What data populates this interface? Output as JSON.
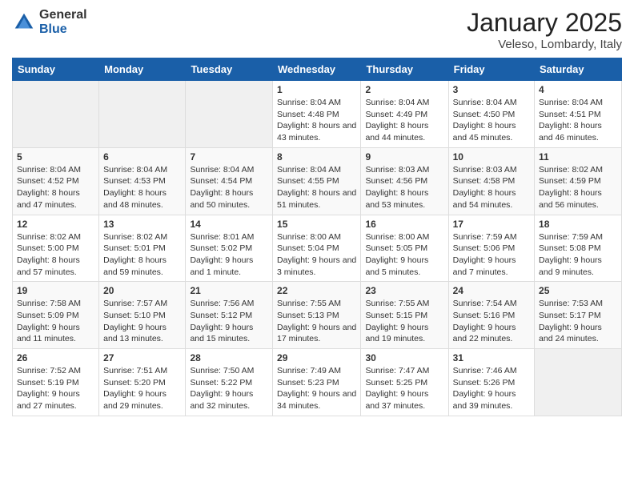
{
  "header": {
    "logo_general": "General",
    "logo_blue": "Blue",
    "month": "January 2025",
    "location": "Veleso, Lombardy, Italy"
  },
  "weekdays": [
    "Sunday",
    "Monday",
    "Tuesday",
    "Wednesday",
    "Thursday",
    "Friday",
    "Saturday"
  ],
  "weeks": [
    [
      {
        "day": "",
        "info": ""
      },
      {
        "day": "",
        "info": ""
      },
      {
        "day": "",
        "info": ""
      },
      {
        "day": "1",
        "info": "Sunrise: 8:04 AM\nSunset: 4:48 PM\nDaylight: 8 hours and 43 minutes."
      },
      {
        "day": "2",
        "info": "Sunrise: 8:04 AM\nSunset: 4:49 PM\nDaylight: 8 hours and 44 minutes."
      },
      {
        "day": "3",
        "info": "Sunrise: 8:04 AM\nSunset: 4:50 PM\nDaylight: 8 hours and 45 minutes."
      },
      {
        "day": "4",
        "info": "Sunrise: 8:04 AM\nSunset: 4:51 PM\nDaylight: 8 hours and 46 minutes."
      }
    ],
    [
      {
        "day": "5",
        "info": "Sunrise: 8:04 AM\nSunset: 4:52 PM\nDaylight: 8 hours and 47 minutes."
      },
      {
        "day": "6",
        "info": "Sunrise: 8:04 AM\nSunset: 4:53 PM\nDaylight: 8 hours and 48 minutes."
      },
      {
        "day": "7",
        "info": "Sunrise: 8:04 AM\nSunset: 4:54 PM\nDaylight: 8 hours and 50 minutes."
      },
      {
        "day": "8",
        "info": "Sunrise: 8:04 AM\nSunset: 4:55 PM\nDaylight: 8 hours and 51 minutes."
      },
      {
        "day": "9",
        "info": "Sunrise: 8:03 AM\nSunset: 4:56 PM\nDaylight: 8 hours and 53 minutes."
      },
      {
        "day": "10",
        "info": "Sunrise: 8:03 AM\nSunset: 4:58 PM\nDaylight: 8 hours and 54 minutes."
      },
      {
        "day": "11",
        "info": "Sunrise: 8:02 AM\nSunset: 4:59 PM\nDaylight: 8 hours and 56 minutes."
      }
    ],
    [
      {
        "day": "12",
        "info": "Sunrise: 8:02 AM\nSunset: 5:00 PM\nDaylight: 8 hours and 57 minutes."
      },
      {
        "day": "13",
        "info": "Sunrise: 8:02 AM\nSunset: 5:01 PM\nDaylight: 8 hours and 59 minutes."
      },
      {
        "day": "14",
        "info": "Sunrise: 8:01 AM\nSunset: 5:02 PM\nDaylight: 9 hours and 1 minute."
      },
      {
        "day": "15",
        "info": "Sunrise: 8:00 AM\nSunset: 5:04 PM\nDaylight: 9 hours and 3 minutes."
      },
      {
        "day": "16",
        "info": "Sunrise: 8:00 AM\nSunset: 5:05 PM\nDaylight: 9 hours and 5 minutes."
      },
      {
        "day": "17",
        "info": "Sunrise: 7:59 AM\nSunset: 5:06 PM\nDaylight: 9 hours and 7 minutes."
      },
      {
        "day": "18",
        "info": "Sunrise: 7:59 AM\nSunset: 5:08 PM\nDaylight: 9 hours and 9 minutes."
      }
    ],
    [
      {
        "day": "19",
        "info": "Sunrise: 7:58 AM\nSunset: 5:09 PM\nDaylight: 9 hours and 11 minutes."
      },
      {
        "day": "20",
        "info": "Sunrise: 7:57 AM\nSunset: 5:10 PM\nDaylight: 9 hours and 13 minutes."
      },
      {
        "day": "21",
        "info": "Sunrise: 7:56 AM\nSunset: 5:12 PM\nDaylight: 9 hours and 15 minutes."
      },
      {
        "day": "22",
        "info": "Sunrise: 7:55 AM\nSunset: 5:13 PM\nDaylight: 9 hours and 17 minutes."
      },
      {
        "day": "23",
        "info": "Sunrise: 7:55 AM\nSunset: 5:15 PM\nDaylight: 9 hours and 19 minutes."
      },
      {
        "day": "24",
        "info": "Sunrise: 7:54 AM\nSunset: 5:16 PM\nDaylight: 9 hours and 22 minutes."
      },
      {
        "day": "25",
        "info": "Sunrise: 7:53 AM\nSunset: 5:17 PM\nDaylight: 9 hours and 24 minutes."
      }
    ],
    [
      {
        "day": "26",
        "info": "Sunrise: 7:52 AM\nSunset: 5:19 PM\nDaylight: 9 hours and 27 minutes."
      },
      {
        "day": "27",
        "info": "Sunrise: 7:51 AM\nSunset: 5:20 PM\nDaylight: 9 hours and 29 minutes."
      },
      {
        "day": "28",
        "info": "Sunrise: 7:50 AM\nSunset: 5:22 PM\nDaylight: 9 hours and 32 minutes."
      },
      {
        "day": "29",
        "info": "Sunrise: 7:49 AM\nSunset: 5:23 PM\nDaylight: 9 hours and 34 minutes."
      },
      {
        "day": "30",
        "info": "Sunrise: 7:47 AM\nSunset: 5:25 PM\nDaylight: 9 hours and 37 minutes."
      },
      {
        "day": "31",
        "info": "Sunrise: 7:46 AM\nSunset: 5:26 PM\nDaylight: 9 hours and 39 minutes."
      },
      {
        "day": "",
        "info": ""
      }
    ]
  ]
}
